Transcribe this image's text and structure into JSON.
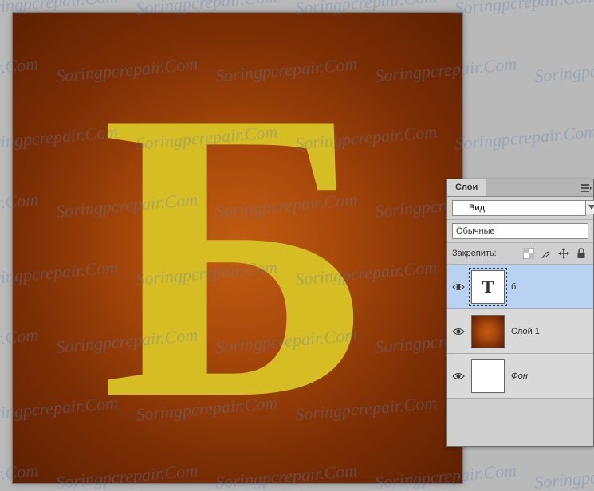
{
  "watermark_text": "Soringpcrepair.Com",
  "canvas": {
    "letter": "Б"
  },
  "panel": {
    "tab_label": "Слои",
    "search_value": "Вид",
    "blend_mode": "Обычные",
    "lock_label": "Закрепить:",
    "layers": [
      {
        "name": "б",
        "type": "text",
        "visible": true,
        "selected": true
      },
      {
        "name": "Слой 1",
        "type": "gradient",
        "visible": true,
        "selected": false
      },
      {
        "name": "Фон",
        "type": "bg",
        "visible": true,
        "selected": false
      }
    ]
  }
}
